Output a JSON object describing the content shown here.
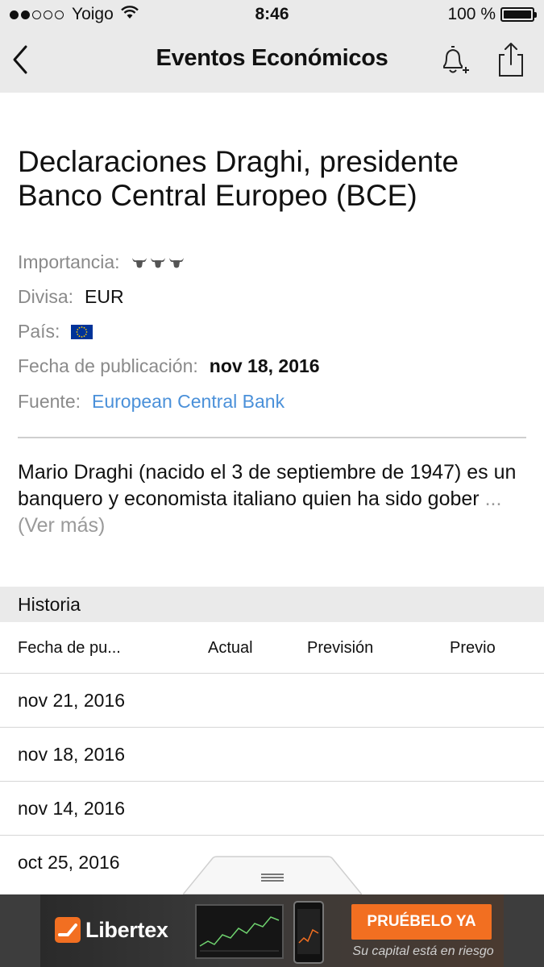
{
  "status_bar": {
    "carrier": "Yoigo",
    "time": "8:46",
    "battery_percent": "100 %",
    "signal_bars_filled": 2,
    "signal_bars_total": 5
  },
  "nav": {
    "title": "Eventos Económicos",
    "back_icon": "chevron-left-icon",
    "alert_icon": "bell-plus-icon",
    "share_icon": "share-icon"
  },
  "event": {
    "title": "Declaraciones Draghi, presidente Banco Central Europeo (BCE)",
    "importance_label": "Importancia:",
    "importance_level": 3,
    "currency_label": "Divisa:",
    "currency_value": "EUR",
    "country_label": "País:",
    "country_flag": "eu-flag-icon",
    "date_label": "Fecha de publicación:",
    "date_value": "nov 18, 2016",
    "source_label": "Fuente:",
    "source_value": "European Central Bank",
    "description": "Mario Draghi (nacido el 3 de septiembre de 1947) es un banquero y economista italiano quien ha sido gober ",
    "more_link": "... (Ver más)"
  },
  "history": {
    "header": "Historia",
    "columns": [
      "Fecha de pu...",
      "Actual",
      "Previsión",
      "Previo"
    ],
    "rows": [
      {
        "date": "nov 21, 2016",
        "actual": "",
        "forecast": "",
        "previous": ""
      },
      {
        "date": "nov 18, 2016",
        "actual": "",
        "forecast": "",
        "previous": ""
      },
      {
        "date": "nov 14, 2016",
        "actual": "",
        "forecast": "",
        "previous": ""
      },
      {
        "date": "oct 25, 2016",
        "actual": "",
        "forecast": "",
        "previous": ""
      }
    ]
  },
  "ad": {
    "brand": "Libertex",
    "cta": "PRUÉBELO YA",
    "disclaimer": "Su capital está en riesgo"
  },
  "colors": {
    "bar_background": "#eaeaea",
    "link_blue": "#4a90d9",
    "muted_gray": "#8a8a8a",
    "ad_orange": "#f26f21"
  }
}
